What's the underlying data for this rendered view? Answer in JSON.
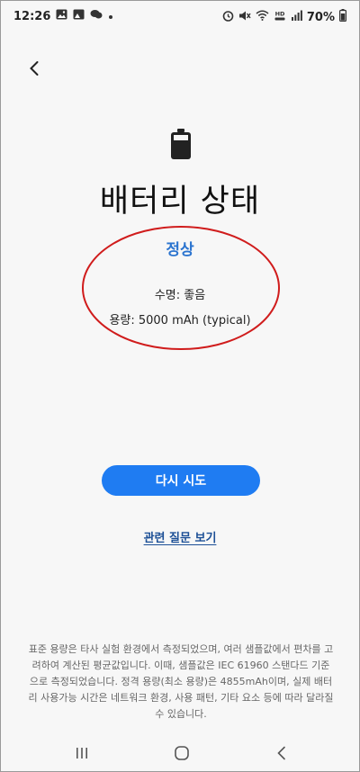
{
  "statusbar": {
    "time": "12:26",
    "battery_percent": "70%"
  },
  "page": {
    "title": "배터리 상태",
    "status": "정상",
    "life": "수명: 좋음",
    "capacity": "용량: 5000 mAh (typical)"
  },
  "actions": {
    "retry_label": "다시 시도",
    "faq_label": "관련 질문 보기"
  },
  "footnote": "표준 용량은 타사 실험 환경에서 측정되었으며, 여러 샘플값에서 편차를 고려하여 계산된 평균값입니다. 이때, 샘플값은 IEC 61960 스탠다드 기준으로 측정되었습니다. 정격 용량(최소 용량)은 4855mAh이며, 실제 배터리 사용가능 시간은 네트워크 환경, 사용 패턴, 기타 요소 등에 따라 달라질 수 있습니다.",
  "colors": {
    "accent": "#1f7cf2",
    "status_text": "#2b74cf",
    "annotation_oval": "#d01c1c"
  },
  "icons": {
    "back": "back-arrow-icon",
    "battery": "battery-icon",
    "recents": "recents-icon",
    "home": "home-icon",
    "nav_back": "nav-back-icon"
  }
}
